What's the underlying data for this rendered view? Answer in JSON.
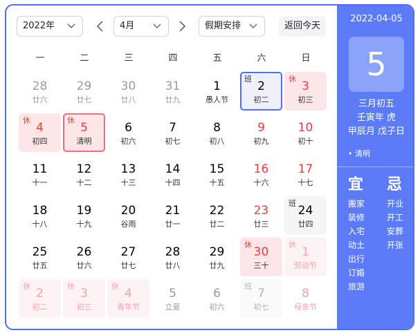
{
  "toolbar": {
    "year": "2022年",
    "month": "4月",
    "holiday": "假期安排",
    "today": "返回今天"
  },
  "weekdays": [
    "一",
    "二",
    "三",
    "四",
    "五",
    "六",
    "日"
  ],
  "days": [
    {
      "day": "28",
      "lunar": "廿六",
      "state": "other"
    },
    {
      "day": "29",
      "lunar": "廿七",
      "state": "other"
    },
    {
      "day": "30",
      "lunar": "廿八",
      "state": "other"
    },
    {
      "day": "31",
      "lunar": "廿九",
      "state": "other"
    },
    {
      "day": "1",
      "lunar": "愚人节",
      "state": "normal"
    },
    {
      "day": "2",
      "lunar": "初二",
      "state": "today",
      "tag": "班"
    },
    {
      "day": "3",
      "lunar": "初三",
      "state": "rest",
      "tag": "休"
    },
    {
      "day": "4",
      "lunar": "初四",
      "state": "rest",
      "tag": "休"
    },
    {
      "day": "5",
      "lunar": "清明",
      "state": "rest-selected",
      "tag": "休"
    },
    {
      "day": "6",
      "lunar": "初六",
      "state": "normal"
    },
    {
      "day": "7",
      "lunar": "初七",
      "state": "normal"
    },
    {
      "day": "8",
      "lunar": "初八",
      "state": "normal"
    },
    {
      "day": "9",
      "lunar": "初九",
      "state": "weekend"
    },
    {
      "day": "10",
      "lunar": "初十",
      "state": "weekend"
    },
    {
      "day": "11",
      "lunar": "十一",
      "state": "normal"
    },
    {
      "day": "12",
      "lunar": "十二",
      "state": "normal"
    },
    {
      "day": "13",
      "lunar": "十三",
      "state": "normal"
    },
    {
      "day": "14",
      "lunar": "十四",
      "state": "normal"
    },
    {
      "day": "15",
      "lunar": "十五",
      "state": "normal"
    },
    {
      "day": "16",
      "lunar": "十六",
      "state": "weekend"
    },
    {
      "day": "17",
      "lunar": "十七",
      "state": "weekend"
    },
    {
      "day": "18",
      "lunar": "十八",
      "state": "normal"
    },
    {
      "day": "19",
      "lunar": "十九",
      "state": "normal"
    },
    {
      "day": "20",
      "lunar": "谷雨",
      "state": "normal"
    },
    {
      "day": "21",
      "lunar": "廿一",
      "state": "normal"
    },
    {
      "day": "22",
      "lunar": "廿二",
      "state": "normal"
    },
    {
      "day": "23",
      "lunar": "廿三",
      "state": "weekend"
    },
    {
      "day": "24",
      "lunar": "廿四",
      "state": "work",
      "tag": "班"
    },
    {
      "day": "25",
      "lunar": "廿五",
      "state": "normal"
    },
    {
      "day": "26",
      "lunar": "廿六",
      "state": "normal"
    },
    {
      "day": "27",
      "lunar": "廿七",
      "state": "normal"
    },
    {
      "day": "28",
      "lunar": "廿八",
      "state": "normal"
    },
    {
      "day": "29",
      "lunar": "廿九",
      "state": "normal"
    },
    {
      "day": "30",
      "lunar": "三十",
      "state": "rest",
      "tag": "休"
    },
    {
      "day": "1",
      "lunar": "劳动节",
      "state": "rest-other",
      "tag": "休"
    },
    {
      "day": "2",
      "lunar": "初二",
      "state": "rest-other",
      "tag": "休"
    },
    {
      "day": "3",
      "lunar": "初三",
      "state": "rest-other",
      "tag": "休"
    },
    {
      "day": "4",
      "lunar": "青年节",
      "state": "rest-other",
      "tag": "休"
    },
    {
      "day": "5",
      "lunar": "立夏",
      "state": "other"
    },
    {
      "day": "6",
      "lunar": "初六",
      "state": "other"
    },
    {
      "day": "7",
      "lunar": "初七",
      "state": "work-other",
      "tag": "班"
    },
    {
      "day": "8",
      "lunar": "母亲节",
      "state": "other-weekend"
    }
  ],
  "side": {
    "date": "2022-04-05",
    "big_day": "5",
    "lunar_date": "三月初五",
    "year_gz": "壬寅年 虎",
    "month_day_gz": "甲辰月 戊子日",
    "festival": "• 清明",
    "yi_title": "宜",
    "yi": [
      "搬家",
      "装修",
      "入宅",
      "动土",
      "出行",
      "订婚",
      "旅游"
    ],
    "ji_title": "忌",
    "ji": [
      "开业",
      "开工",
      "安葬",
      "开张"
    ]
  },
  "colors": {
    "accent": "#4e6ef2",
    "side_bg": "#5b7cf6",
    "holiday_red": "#f03c3c",
    "rest_bg": "#fde6e7"
  }
}
